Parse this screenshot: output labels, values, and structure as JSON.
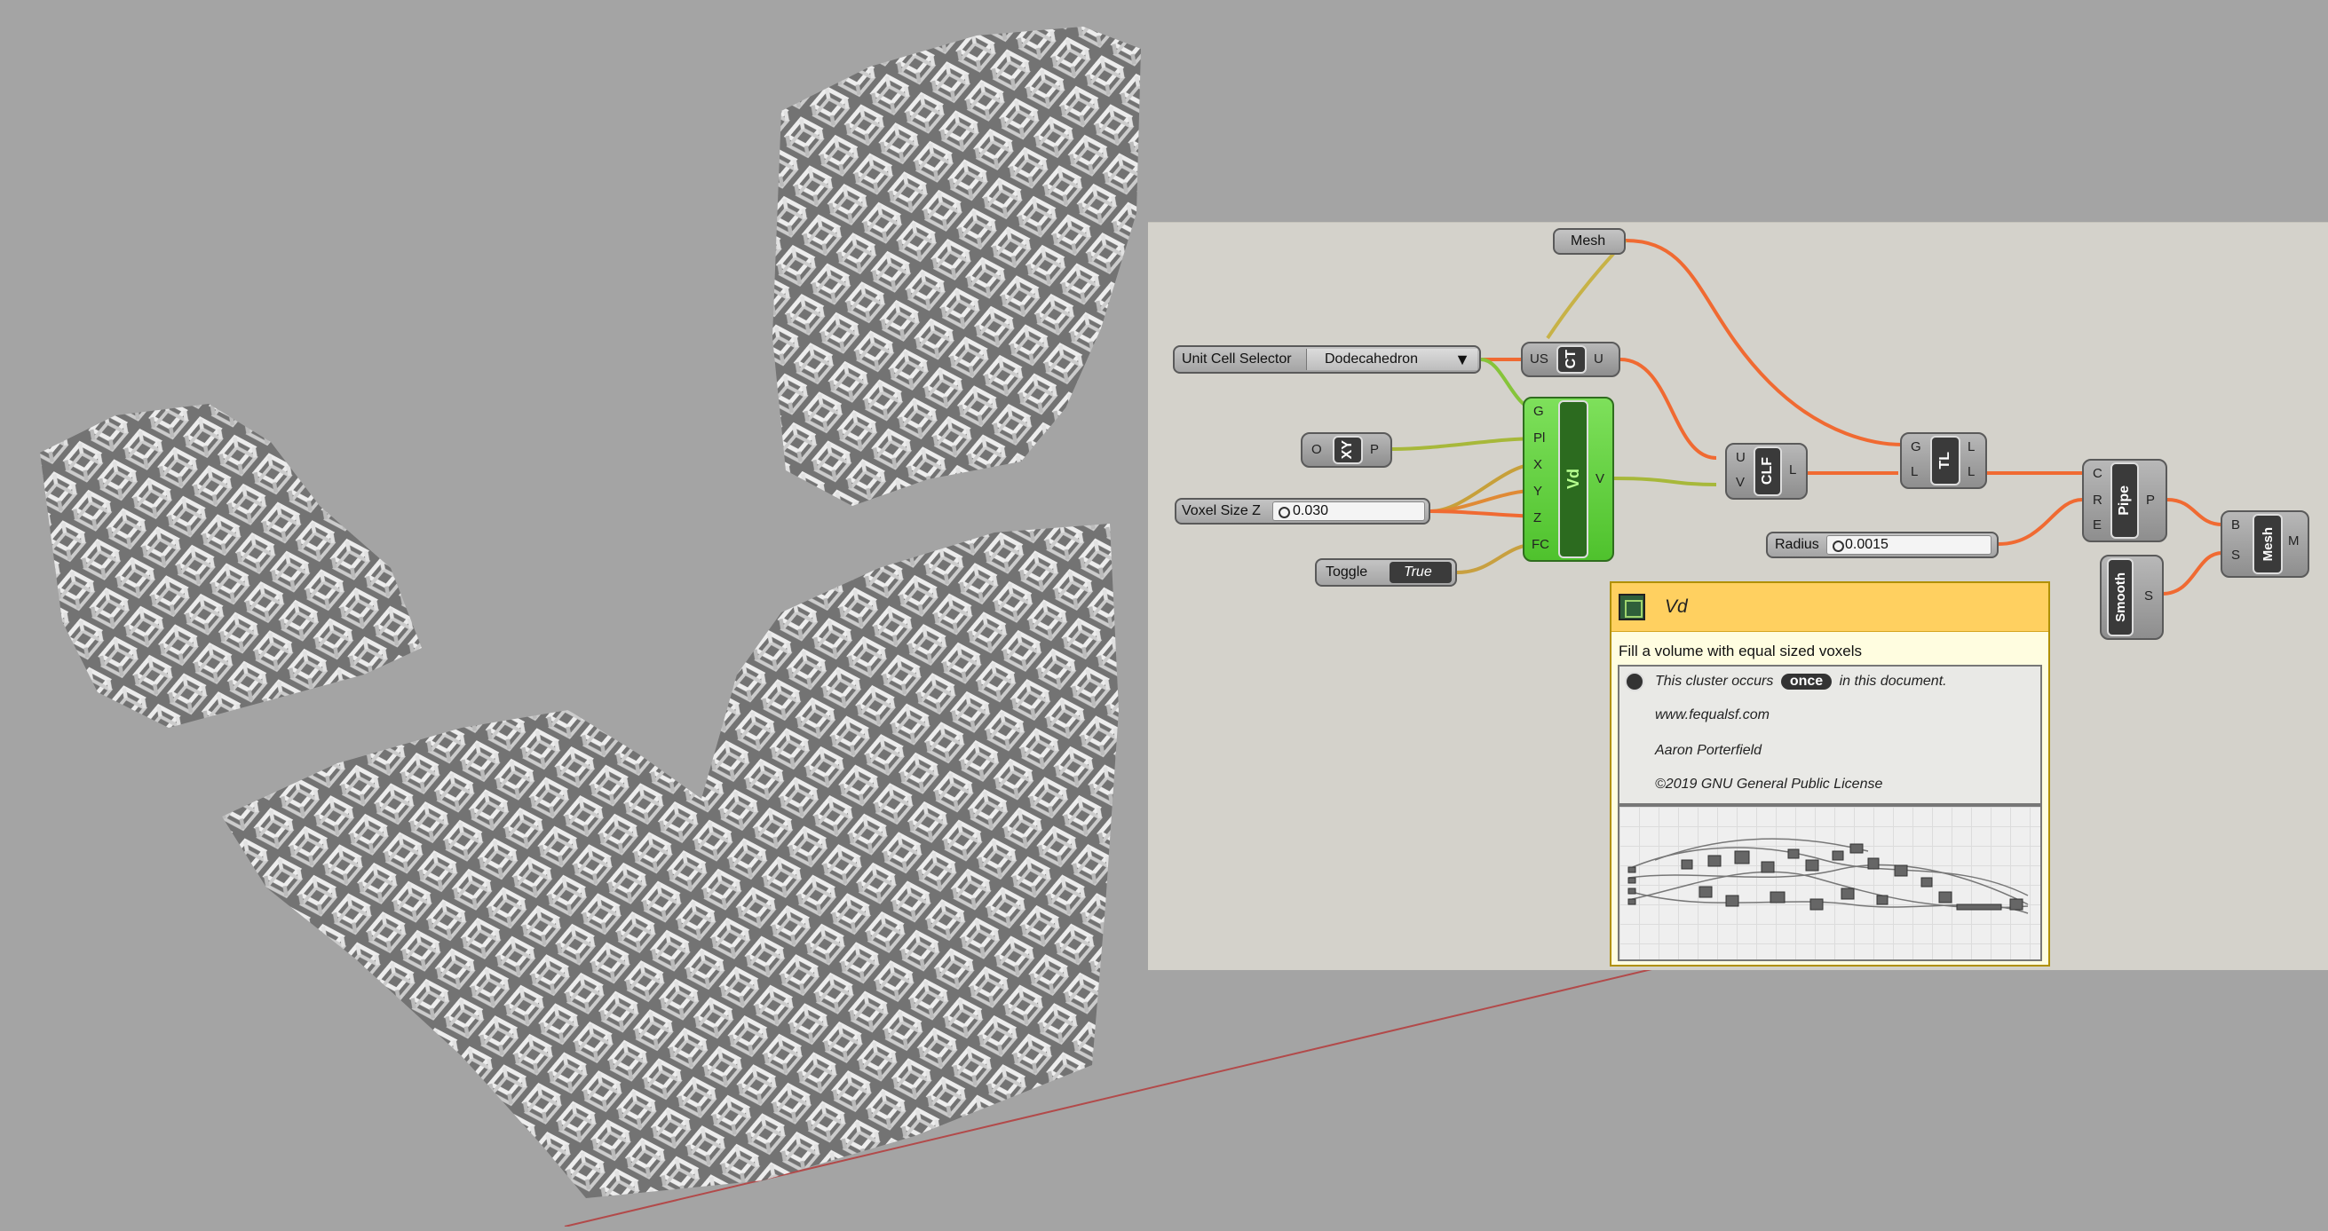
{
  "inputs": {
    "unit_cell_selector": {
      "label": "Unit Cell Selector",
      "value": "Dodecahedron"
    },
    "voxel_size": {
      "label": "Voxel Size Z",
      "value": "0.030"
    },
    "toggle": {
      "label": "Toggle",
      "value": "True"
    },
    "radius": {
      "label": "Radius",
      "value": "0.0015"
    },
    "mesh_param": {
      "label": "Mesh"
    }
  },
  "components": {
    "xy": {
      "name": "XY",
      "in": [
        "O"
      ],
      "out": [
        "P"
      ]
    },
    "ct": {
      "name": "CT",
      "in": [
        "US"
      ],
      "out": [
        "U"
      ]
    },
    "vd": {
      "name": "Vd",
      "in": [
        "G",
        "Pl",
        "X",
        "Y",
        "Z",
        "FC"
      ],
      "out": [
        "V"
      ]
    },
    "clf": {
      "name": "CLF",
      "in": [
        "U",
        "V"
      ],
      "out": [
        "L"
      ]
    },
    "tl": {
      "name": "TL",
      "in": [
        "G",
        "L"
      ],
      "out": [
        "L",
        "L"
      ]
    },
    "pipe": {
      "name": "Pipe",
      "in": [
        "C",
        "R",
        "E"
      ],
      "out": [
        "P"
      ]
    },
    "smooth": {
      "name": "Smooth",
      "out": [
        "S"
      ]
    },
    "mesh": {
      "name": "Mesh",
      "in": [
        "B",
        "S"
      ],
      "out": [
        "M"
      ]
    }
  },
  "tooltip": {
    "title": "Vd",
    "description": "Fill a volume with equal sized voxels",
    "occurs_prefix": "This cluster occurs",
    "occurs_badge": "once",
    "occurs_suffix": "in this document.",
    "website": "www.fequalsf.com",
    "author": "Aaron Porterfield",
    "license": "©2019 GNU General Public License"
  },
  "colors": {
    "wire_orange": "#f06a32",
    "wire_green": "#86c43a",
    "cluster_green": "#5acb35",
    "tooltip_header": "#ffd060"
  }
}
